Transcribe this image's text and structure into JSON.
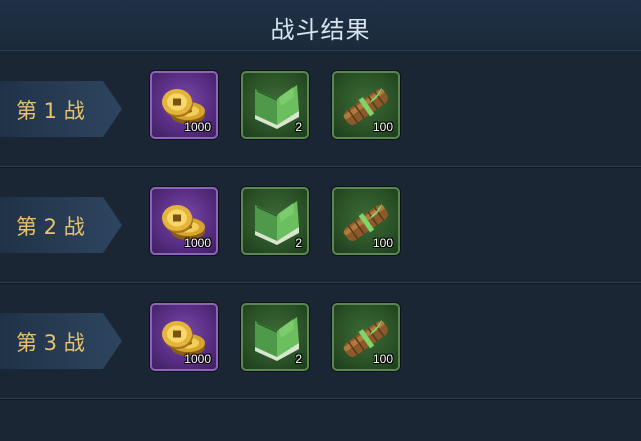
{
  "title": "战斗结果",
  "battles": [
    {
      "label": "第 1 战",
      "rewards": [
        {
          "icon": "gold-coins-icon",
          "quantity": "1000"
        },
        {
          "icon": "green-book-icon",
          "quantity": "2"
        },
        {
          "icon": "bamboo-scroll-icon",
          "quantity": "100"
        }
      ]
    },
    {
      "label": "第 2 战",
      "rewards": [
        {
          "icon": "gold-coins-icon",
          "quantity": "1000"
        },
        {
          "icon": "green-book-icon",
          "quantity": "2"
        },
        {
          "icon": "bamboo-scroll-icon",
          "quantity": "100"
        }
      ]
    },
    {
      "label": "第 3 战",
      "rewards": [
        {
          "icon": "gold-coins-icon",
          "quantity": "1000"
        },
        {
          "icon": "green-book-icon",
          "quantity": "2"
        },
        {
          "icon": "bamboo-scroll-icon",
          "quantity": "100"
        }
      ]
    }
  ],
  "colors": {
    "background": "#1a2633",
    "title_text": "#d9e3ee",
    "battle_label": "#e8c36c",
    "purple_slot": "#5a2f85",
    "green_slot": "#2b5227"
  }
}
